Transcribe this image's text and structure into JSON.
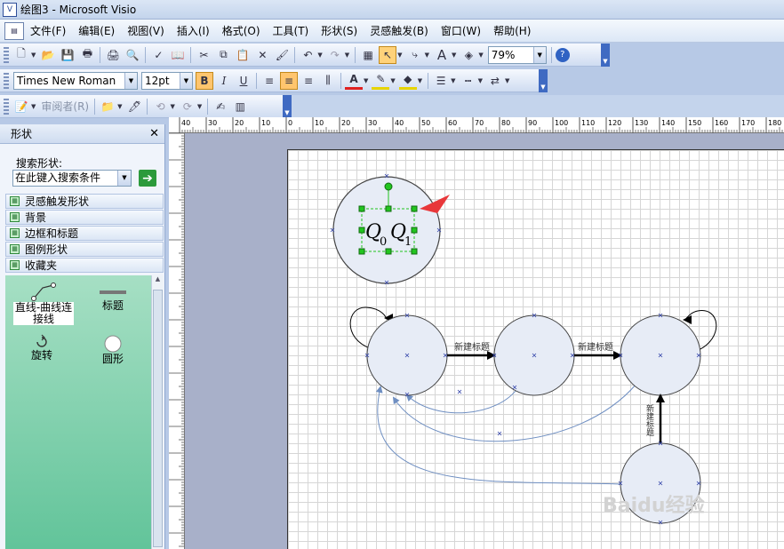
{
  "window": {
    "title": "绘图3 - Microsoft Visio"
  },
  "menu": [
    "文件(F)",
    "编辑(E)",
    "视图(V)",
    "插入(I)",
    "格式(O)",
    "工具(T)",
    "形状(S)",
    "灵感触发(B)",
    "窗口(W)",
    "帮助(H)"
  ],
  "toolbar_standard": {
    "zoom": "79%"
  },
  "toolbar_format": {
    "font": "Times New Roman",
    "size": "12pt",
    "bold": "B",
    "italic": "I",
    "underline": "U",
    "font_color_label": "A"
  },
  "toolbar_review": {
    "reviewer_label": "审阅者(R)"
  },
  "shapes_panel": {
    "title": "形状",
    "search_label": "搜索形状:",
    "search_placeholder": "在此键入搜索条件",
    "categories": [
      "灵感触发形状",
      "背景",
      "边框和标题",
      "图例形状",
      "收藏夹"
    ],
    "stencil": [
      {
        "label": "直线-曲线连接线",
        "icon": "connector-icon"
      },
      {
        "label": "标题",
        "icon": "title-icon"
      },
      {
        "label": "旋转",
        "icon": "rotate-icon"
      },
      {
        "label": "圆形",
        "icon": "circle-icon"
      }
    ]
  },
  "ruler": {
    "h_ticks": [
      "40",
      "30",
      "20",
      "10",
      "0",
      "10",
      "20",
      "30",
      "40",
      "50",
      "60",
      "70",
      "80",
      "90",
      "100",
      "110",
      "120",
      "130",
      "140",
      "150",
      "160",
      "170",
      "180"
    ]
  },
  "diagram": {
    "selected_text_base": "Q",
    "selected_text_sub0": "0",
    "selected_text_sub1": "1",
    "edge_labels": [
      "新建标题",
      "新建标题",
      "新建标题"
    ],
    "colors": {
      "state_fill": "#e7ecf6",
      "selection_handle": "#22c51f",
      "arrow_red": "#e8373a",
      "curve": "#6f8fc2"
    }
  },
  "watermark": "Baidu经验"
}
